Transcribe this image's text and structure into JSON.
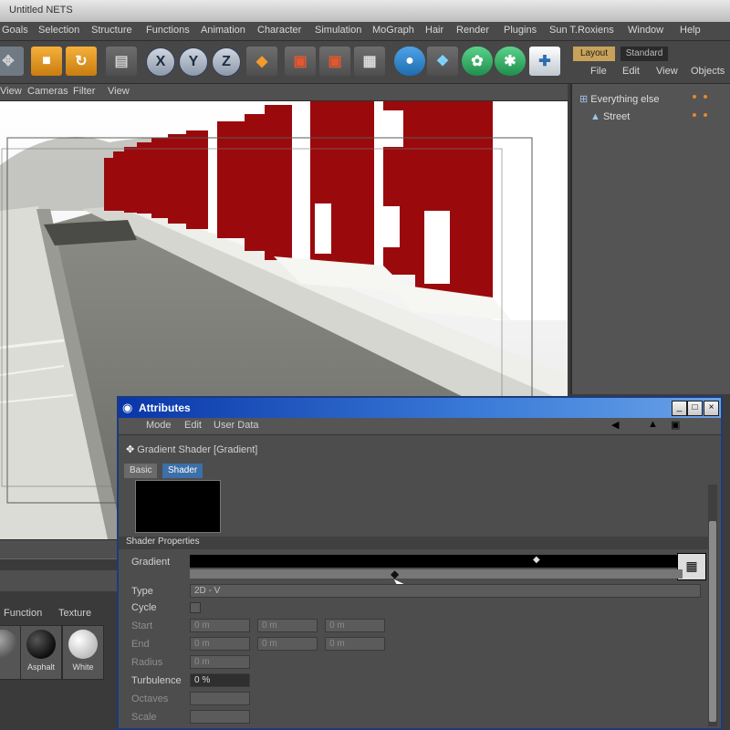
{
  "app": {
    "title": "Untitled NETS"
  },
  "menubar": [
    "Goals",
    "Selection",
    "Structure",
    "Functions",
    "Animation",
    "Character",
    "Simulation",
    "MoGraph",
    "Hair",
    "Render",
    "Plugins",
    "Sun T.Roxiens",
    "Window",
    "Help"
  ],
  "toolbar": {
    "icons": [
      "move-icon",
      "scale-icon",
      "rotate-icon",
      "clapboard-icon",
      "x-axis-icon",
      "y-axis-icon",
      "z-axis-icon",
      "world-icon",
      "render-view-icon",
      "render-picture-icon",
      "render-settings-icon",
      "cube-primitive-icon",
      "nurbs-icon",
      "array-icon",
      "deformer-icon",
      "light-icon"
    ],
    "xyz_labels": [
      "X",
      "Y",
      "Z"
    ]
  },
  "layout_tabs": [
    "Layout",
    "Standard"
  ],
  "viewport_menu": [
    "View",
    "Cameras",
    "Filter",
    "View"
  ],
  "object_manager": {
    "menu": [
      "File",
      "Edit",
      "View",
      "Objects"
    ],
    "objects": [
      {
        "label": "Everything else"
      },
      {
        "label": "Street"
      }
    ]
  },
  "materials": {
    "menu": [
      "Function",
      "Texture"
    ],
    "items": [
      {
        "label": "Asphalt",
        "color": "#1a1a1a"
      },
      {
        "label": "White",
        "color": "#e8e8e8"
      }
    ]
  },
  "attributes": {
    "title": "Attributes",
    "menu": [
      "Mode",
      "Edit",
      "User Data"
    ],
    "shader_name": "Gradient Shader [Gradient]",
    "tabs": [
      "Basic",
      "Shader"
    ],
    "active_tab": "Shader",
    "section": "Shader Properties",
    "gradient_label": "Gradient",
    "type_label": "Type",
    "type_value": "2D - V",
    "cycle_label": "Cycle",
    "rows": [
      {
        "label": "Start",
        "values": [
          "0 m",
          "0 m",
          "0 m"
        ]
      },
      {
        "label": "End",
        "values": [
          "0 m",
          "0 m",
          "0 m"
        ]
      },
      {
        "label": "Radius",
        "values": [
          "0 m"
        ]
      }
    ],
    "turbulence_label": "Turbulence",
    "turbulence_value": "0 %",
    "octaves_label": "Octaves",
    "scale_label": "Scale"
  },
  "colors": {
    "building_red": "#9a0a0d",
    "title_blue": "#1a4cc0"
  }
}
